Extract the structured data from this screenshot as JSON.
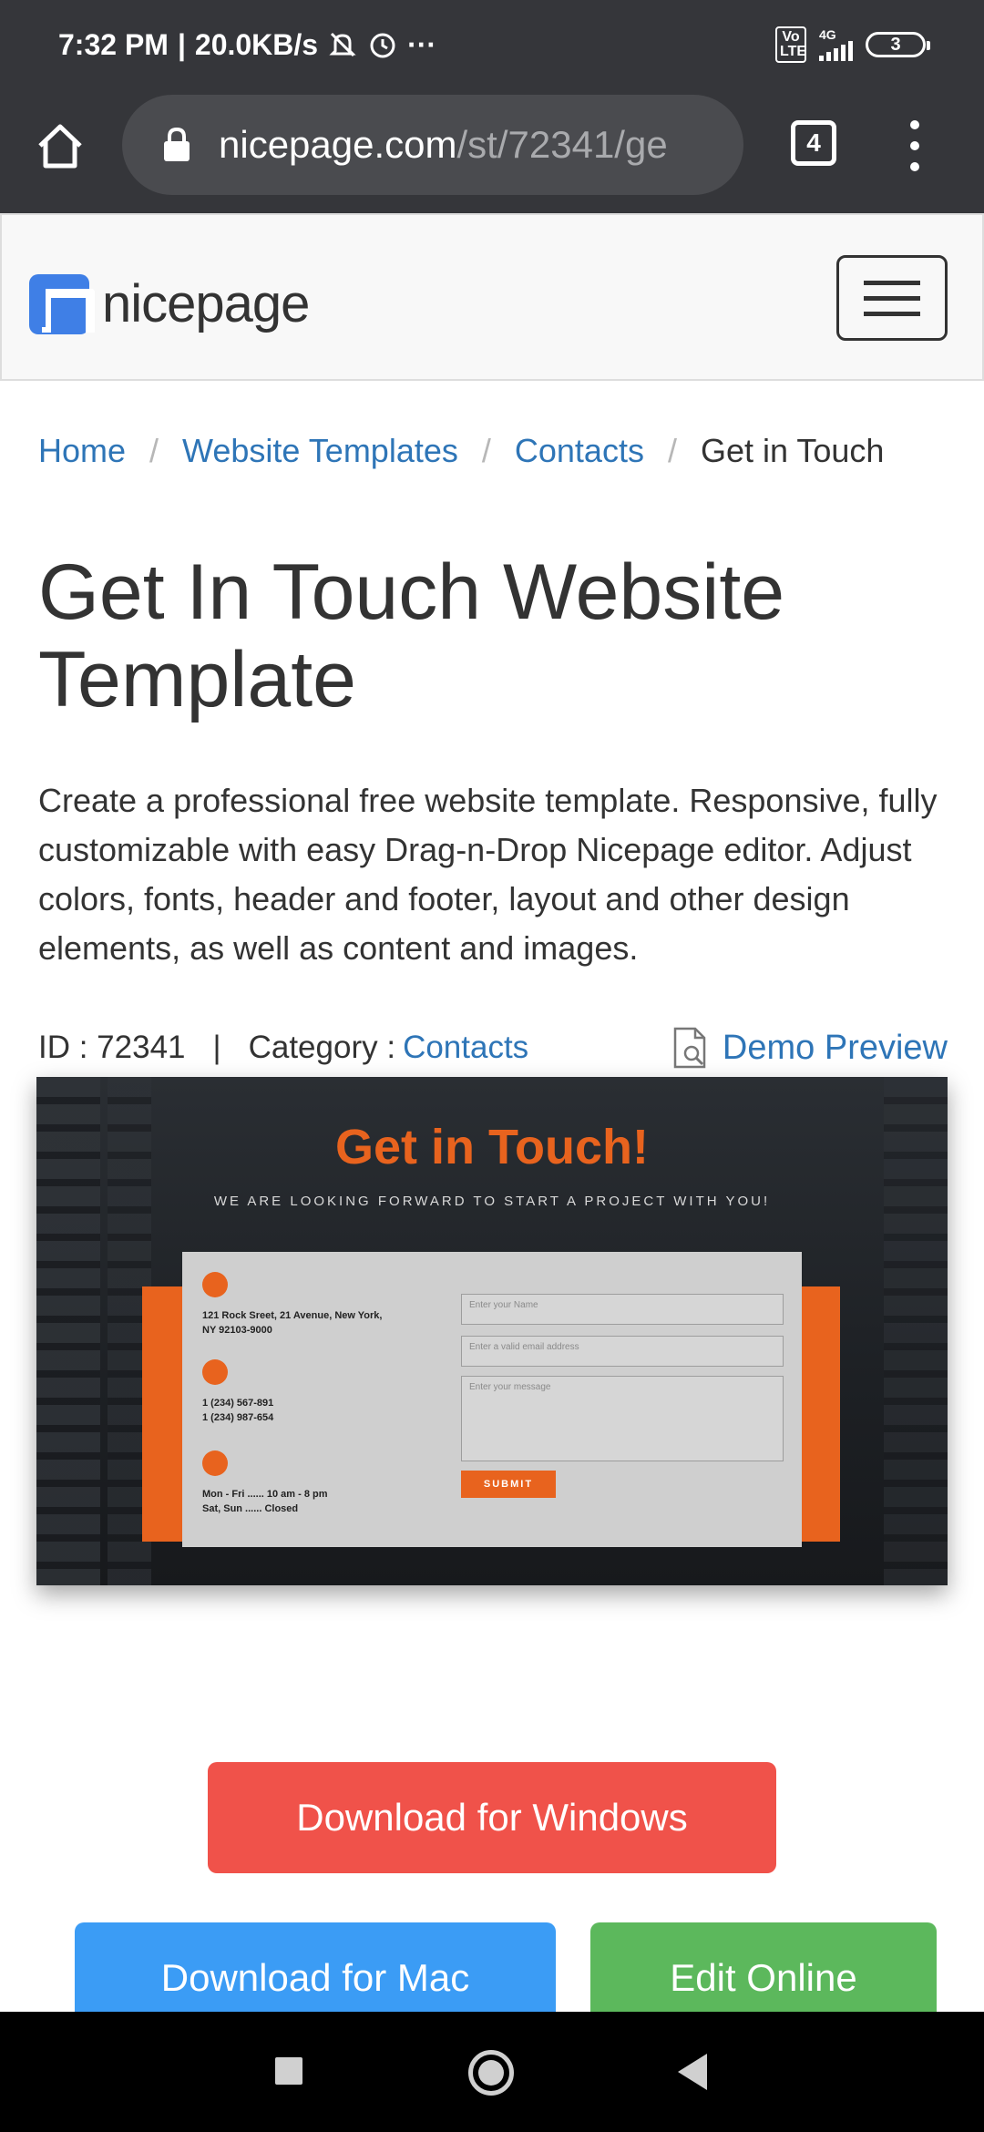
{
  "status_bar": {
    "time": "7:32 PM",
    "separator": "|",
    "net_speed": "20.0KB/s",
    "more": "···",
    "network_type": "4G",
    "volte": "Vo LTE",
    "battery": "3"
  },
  "browser": {
    "url_domain": "nicepage.com",
    "url_path": "/st/72341/ge",
    "tab_count": "4"
  },
  "site_header": {
    "logo_text": "nicepage"
  },
  "breadcrumb": {
    "items": [
      "Home",
      "Website Templates",
      "Contacts"
    ],
    "separator": "/",
    "current": "Get in Touch"
  },
  "page": {
    "title": "Get In Touch Website Template",
    "description": "Create a professional free website template. Responsive, fully customizable with easy Drag-n-Drop Nicepage editor. Adjust colors, fonts, header and footer, layout and other design elements, as well as content and images.",
    "id_label": "ID : 72341",
    "meta_separator": "|",
    "category_label": "Category :",
    "category_value": "Contacts",
    "demo_preview_label": "Demo Preview"
  },
  "preview": {
    "title": "Get in Touch!",
    "subtitle": "WE ARE LOOKING FORWARD TO START A PROJECT WITH YOU!",
    "address_line1": "121 Rock Sreet, 21 Avenue, New York,",
    "address_line2": "NY 92103-9000",
    "phone_line1": "1 (234) 567-891",
    "phone_line2": "1 (234) 987-654",
    "hours_line1": "Mon - Fri ...... 10 am - 8 pm",
    "hours_line2": "Sat, Sun ...... Closed",
    "name_placeholder": "Enter your Name",
    "email_placeholder": "Enter a valid email address",
    "message_placeholder": "Enter your message",
    "submit_label": "SUBMIT",
    "accent_color": "#e8631e"
  },
  "actions": {
    "download_windows": "Download for Windows",
    "download_mac": "Download for Mac",
    "edit_online": "Edit Online",
    "windows_color": "#f0524a",
    "mac_color": "#3b9cf5",
    "online_color": "#5cb85c"
  },
  "icons": {
    "status_bar": [
      "mute-bell-icon",
      "alarm-icon",
      "signal-icon",
      "battery-icon"
    ],
    "browser": [
      "home-icon",
      "lock-icon",
      "tabs-icon",
      "overflow-menu-icon"
    ],
    "navigation": [
      "recents-icon",
      "home-nav-icon",
      "back-icon"
    ]
  }
}
